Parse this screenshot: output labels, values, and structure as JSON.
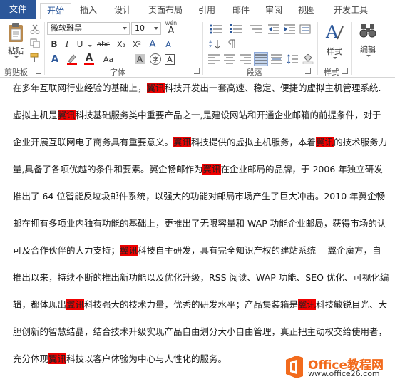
{
  "tabs": [
    "文件",
    "开始",
    "插入",
    "设计",
    "页面布局",
    "引用",
    "邮件",
    "审阅",
    "视图",
    "开发工具"
  ],
  "font": {
    "name": "微软雅黑",
    "size": "10",
    "wen_label": "wén",
    "wen_char": "A"
  },
  "clipboard": {
    "paste_label": "粘贴",
    "group_label": "剪贴板"
  },
  "font_group_label": "字体",
  "paragraph_group_label": "段落",
  "styles": {
    "label": "样式",
    "group_label": "样式"
  },
  "editing": {
    "label": "编辑"
  },
  "format_buttons": {
    "bold": "B",
    "italic": "I",
    "underline": "U",
    "strike": "abc",
    "subscript": "X₂",
    "superscript": "X²",
    "font_color": "A",
    "highlight": "A",
    "case": "Aa",
    "grow": "A",
    "shrink": "A",
    "clear": "A",
    "char_shade": "A",
    "enclose": "字",
    "phonetic": "A",
    "border_char": "A"
  },
  "highlight_color": "#f00000",
  "brand_color": "#2b579a",
  "watermark": {
    "title": "Office教程网",
    "url": "www.office26.com"
  },
  "document": {
    "lines": [
      [
        {
          "t": "在多年互联网行业经验的基础上，"
        },
        {
          "t": "翼讯",
          "h": true
        },
        {
          "t": "科技开发出一套高速、稳定、便捷的虚拟主机管理系统."
        }
      ],
      [
        {
          "t": "虚拟主机是"
        },
        {
          "t": "翼讯",
          "h": true
        },
        {
          "t": "科技基础服务类中重要产品之一,是建设网站和开通企业邮箱的前提条件，对于"
        }
      ],
      [
        {
          "t": "企业开展互联网电子商务具有重要意义。"
        },
        {
          "t": "翼讯",
          "h": true
        },
        {
          "t": "科技提供的虚拟主机服务，本着"
        },
        {
          "t": "翼讯",
          "h": true
        },
        {
          "t": "的技术服务力"
        }
      ],
      [
        {
          "t": "量,具备了各项优越的条件和要素。翼企畅邮作为"
        },
        {
          "t": "翼讯",
          "h": true
        },
        {
          "t": "在企业邮局的品牌，于 2006 年独立研发"
        }
      ],
      [
        {
          "t": "推出了 64 位智能反垃圾邮件系统，以强大的功能对邮局市场产生了巨大冲击。2010 年翼企畅"
        }
      ],
      [
        {
          "t": "邮在拥有多项业内独有功能的基础上，更推出了无限容量和 WAP 功能企业邮局，获得市场的认"
        }
      ],
      [
        {
          "t": "可及合作伙伴的大力支持；"
        },
        {
          "t": "翼讯",
          "h": true
        },
        {
          "t": "科技自主研发，具有完全知识产权的建站系统 —翼企魔方，自"
        }
      ],
      [
        {
          "t": "推出以来，持续不断的推出新功能以及优化升级，RSS 阅读、WAP 功能、SEO 优化、可视化编"
        }
      ],
      [
        {
          "t": "辑，都体现出"
        },
        {
          "t": "翼讯",
          "h": true
        },
        {
          "t": "科技强大的技术力量，优秀的研发水平；产品集装箱是"
        },
        {
          "t": "翼讯",
          "h": true
        },
        {
          "t": "科技敏锐目光、大"
        }
      ],
      [
        {
          "t": "胆创新的智慧结晶，结合技术升级实现产品自由划分大小自由管理，真正把主动权交给使用者，"
        }
      ],
      [
        {
          "t": "充分体现"
        },
        {
          "t": "翼讯",
          "h": true
        },
        {
          "t": "科技以客户体验为中心与人性化的服务。"
        }
      ]
    ]
  }
}
